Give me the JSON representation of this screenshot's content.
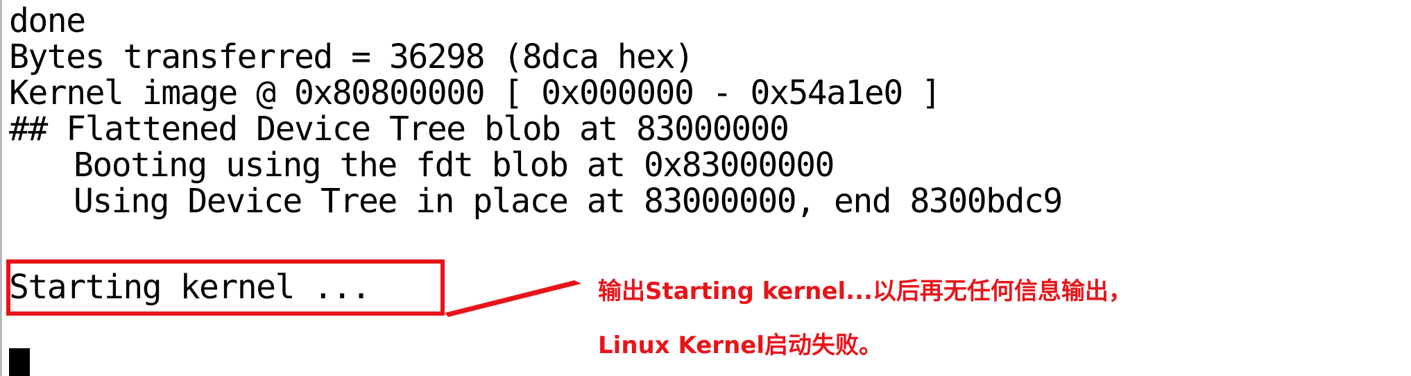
{
  "terminal": {
    "lines": [
      "done",
      "Bytes transferred = 36298 (8dca hex)",
      "Kernel image @ 0x80800000 [ 0x000000 - 0x54a1e0 ]",
      "## Flattened Device Tree blob at 83000000",
      "Booting using the fdt blob at 0x83000000",
      "Using Device Tree in place at 83000000, end 8300bdc9",
      "Starting kernel ..."
    ]
  },
  "annotation": {
    "line1": "输出Starting kernel...以后再无任何信息输出，",
    "line2": "Linux Kernel启动失败。"
  },
  "colors": {
    "highlight": "#e8141a",
    "text": "#000000",
    "background": "#ffffff"
  }
}
